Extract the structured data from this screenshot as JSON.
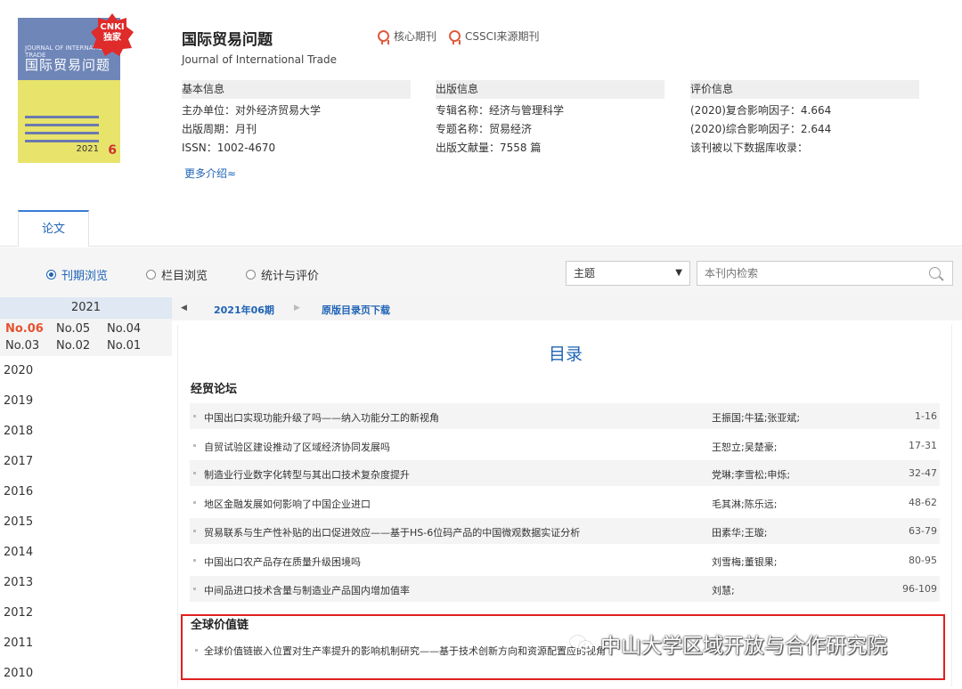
{
  "journal": {
    "badge_line1": "CNKI",
    "badge_line2": "独家",
    "cover_title": "国际贸易问题",
    "cover_subtitle": "JOURNAL OF INTERNATIONAL TRADE",
    "cover_year": "2021",
    "cover_issue": "6",
    "name_cn": "国际贸易问题",
    "name_en": "Journal of International Trade",
    "tag_core": "核心期刊",
    "tag_cssci": "CSSCI来源期刊",
    "more": "更多介绍≈"
  },
  "info": {
    "basic": {
      "head": "基本信息",
      "rows": [
        "主办单位：对外经济贸易大学",
        "出版周期：月刊",
        "ISSN：1002-4670"
      ]
    },
    "publish": {
      "head": "出版信息",
      "rows": [
        "专辑名称：经济与管理科学",
        "专题名称：贸易经济",
        "出版文献量：7558 篇"
      ]
    },
    "rating": {
      "head": "评价信息",
      "rows": [
        "(2020)复合影响因子：4.664",
        "(2020)综合影响因子：2.644",
        "该刊被以下数据库收录："
      ]
    }
  },
  "tabs": {
    "papers": "论文"
  },
  "modes": {
    "issue": "刊期浏览",
    "column": "栏目浏览",
    "stats": "统计与评价"
  },
  "search": {
    "field": "主题",
    "placeholder": "本刊内检索"
  },
  "years": {
    "current": "2021",
    "issues": [
      "No.06",
      "No.05",
      "No.04",
      "No.03",
      "No.02",
      "No.01"
    ],
    "list": [
      "2020",
      "2019",
      "2018",
      "2017",
      "2016",
      "2015",
      "2014",
      "2013",
      "2012",
      "2011",
      "2010"
    ]
  },
  "issuebar": {
    "current": "2021年06期",
    "download": "原版目录页下载"
  },
  "toc": {
    "title": "目录",
    "section1": "经贸论坛",
    "articles": [
      {
        "title": "中国出口实现功能升级了吗——纳入功能分工的新视角",
        "authors": "王振国;牛猛;张亚斌;",
        "pages": "1-16"
      },
      {
        "title": "自贸试验区建设推动了区域经济协同发展吗",
        "authors": "王恕立;吴楚豪;",
        "pages": "17-31"
      },
      {
        "title": "制造业行业数字化转型与其出口技术复杂度提升",
        "authors": "党琳;李雪松;申烁;",
        "pages": "32-47"
      },
      {
        "title": "地区金融发展如何影响了中国企业进口",
        "authors": "毛其淋;陈乐远;",
        "pages": "48-62"
      },
      {
        "title": "贸易联系与生产性补贴的出口促进效应——基于HS-6位码产品的中国微观数据实证分析",
        "authors": "田素华;王璇;",
        "pages": "63-79"
      },
      {
        "title": "中国出口农产品存在质量升级困境吗",
        "authors": "刘雪梅;董银果;",
        "pages": "80-95"
      },
      {
        "title": "中间品进口技术含量与制造业产品国内增加值率",
        "authors": "刘慧;",
        "pages": "96-109"
      }
    ],
    "section2": "全球价值链",
    "last_article": "全球价值链嵌入位置对生产率提升的影响机制研究——基于技术创新方向和资源配置应的视角"
  },
  "watermark": "中山大学区域开放与合作研究院"
}
